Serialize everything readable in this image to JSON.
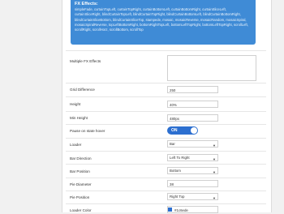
{
  "fx_box": {
    "title": "FX Effects:",
    "text": "simpleFade, curtainTopLeft, curtainTopRight, curtainBottomLeft, curtainBottomRight, curtainSliceLeft, curtainSliceRight, blindCurtainTopLeft, blindCurtainTopRight, blindCurtainBottomLeft, blindCurtainBottomRight, blindCurtainSliceBottom, blindCurtainSliceTop, stampede, mosaic, mosaicReverse, mosaicRandom, mosaicSpiral, mosaicSpiralReverse, topLeftBottomRight, bottomRightTopLeft, bottomLeftTopRight, bottomLeftTopRight, scrollLeft, scrollRight, scrollHorz, scrollBottom, scrollTop"
  },
  "fields": {
    "multiple_fx": {
      "label": "Multiple FX Effects"
    },
    "grid_difference": {
      "label": "Grid Difference",
      "value": "250"
    },
    "height": {
      "label": "Height",
      "value": "40%"
    },
    "min_height": {
      "label": "Min Height",
      "value": "480px"
    },
    "pause_on_hover": {
      "label": "Pause on state hover",
      "value": "ON"
    },
    "loader": {
      "label": "Loader",
      "value": "Bar"
    },
    "bar_direction": {
      "label": "Bar Direction",
      "value": "Left To Right"
    },
    "bar_position": {
      "label": "Bar Position",
      "value": "Bottom"
    },
    "pie_diameter": {
      "label": "Pie Diameter",
      "value": "38"
    },
    "pie_position": {
      "label": "Pie Position",
      "value": "Right Top"
    },
    "loader_color": {
      "label": "Loader Color",
      "value": "#1c6ede"
    }
  },
  "colors": {
    "accent": "#3f8bd6",
    "toggle": "#2c6fd0",
    "swatch": "#1c6ede"
  },
  "icons": {
    "select_caret": "chevron-down-icon"
  }
}
